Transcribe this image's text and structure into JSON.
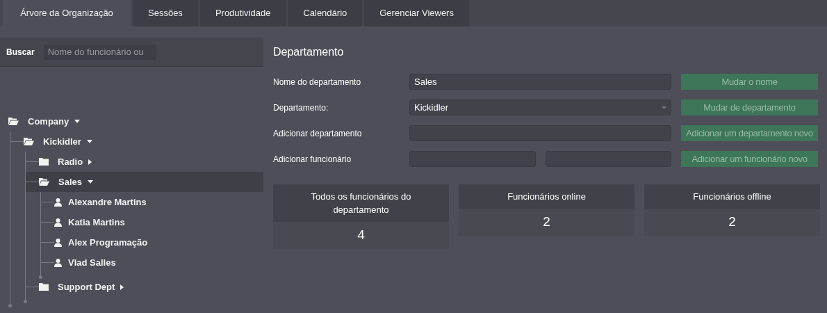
{
  "tabs": [
    {
      "label": "Árvore da Organização",
      "selected": true
    },
    {
      "label": "Sessões",
      "selected": false
    },
    {
      "label": "Produtividade",
      "selected": false
    },
    {
      "label": "Calendário",
      "selected": false
    },
    {
      "label": "Gerenciar Viewers",
      "selected": false
    }
  ],
  "search": {
    "label": "Buscar",
    "placeholder": "Nome do funcionário ou"
  },
  "tree": [
    {
      "kind": "folder",
      "label": "Company",
      "expanded": true,
      "selected": false,
      "children": [
        {
          "kind": "folder",
          "label": "Kickidler",
          "expanded": true,
          "selected": false,
          "children": [
            {
              "kind": "folder",
              "label": "Radio",
              "expanded": false,
              "selected": false
            },
            {
              "kind": "folder",
              "label": "Sales",
              "expanded": true,
              "selected": true,
              "children": [
                {
                  "kind": "person",
                  "label": "Alexandre Martins",
                  "selected": false
                },
                {
                  "kind": "person",
                  "label": "Katia Martins",
                  "selected": false
                },
                {
                  "kind": "person",
                  "label": "Alex Programação",
                  "selected": false
                },
                {
                  "kind": "person",
                  "label": "Vlad Salles",
                  "selected": false
                }
              ]
            },
            {
              "kind": "folder",
              "label": "Support Dept",
              "expanded": false,
              "selected": false
            }
          ]
        }
      ]
    }
  ],
  "department": {
    "title": "Departamento",
    "rows": [
      {
        "label": "Nome do departamento",
        "kind": "text",
        "value": "Sales",
        "button": "Mudar o nome"
      },
      {
        "label": "Departamento:",
        "kind": "select",
        "value": "Kickidler",
        "button": "Mudar de departamento"
      },
      {
        "label": "Adicionar departamento",
        "kind": "text",
        "value": null,
        "button": "Adicionar um departamento novo"
      },
      {
        "label": "Adicionar funcionário",
        "kind": "double",
        "button": "Adicionar um funcionário novo"
      }
    ],
    "stats": [
      {
        "label": "Todos os funcionários do departamento",
        "value": "4"
      },
      {
        "label": "Funcionários online",
        "value": "2"
      },
      {
        "label": "Funcionários offline",
        "value": "2"
      }
    ]
  }
}
